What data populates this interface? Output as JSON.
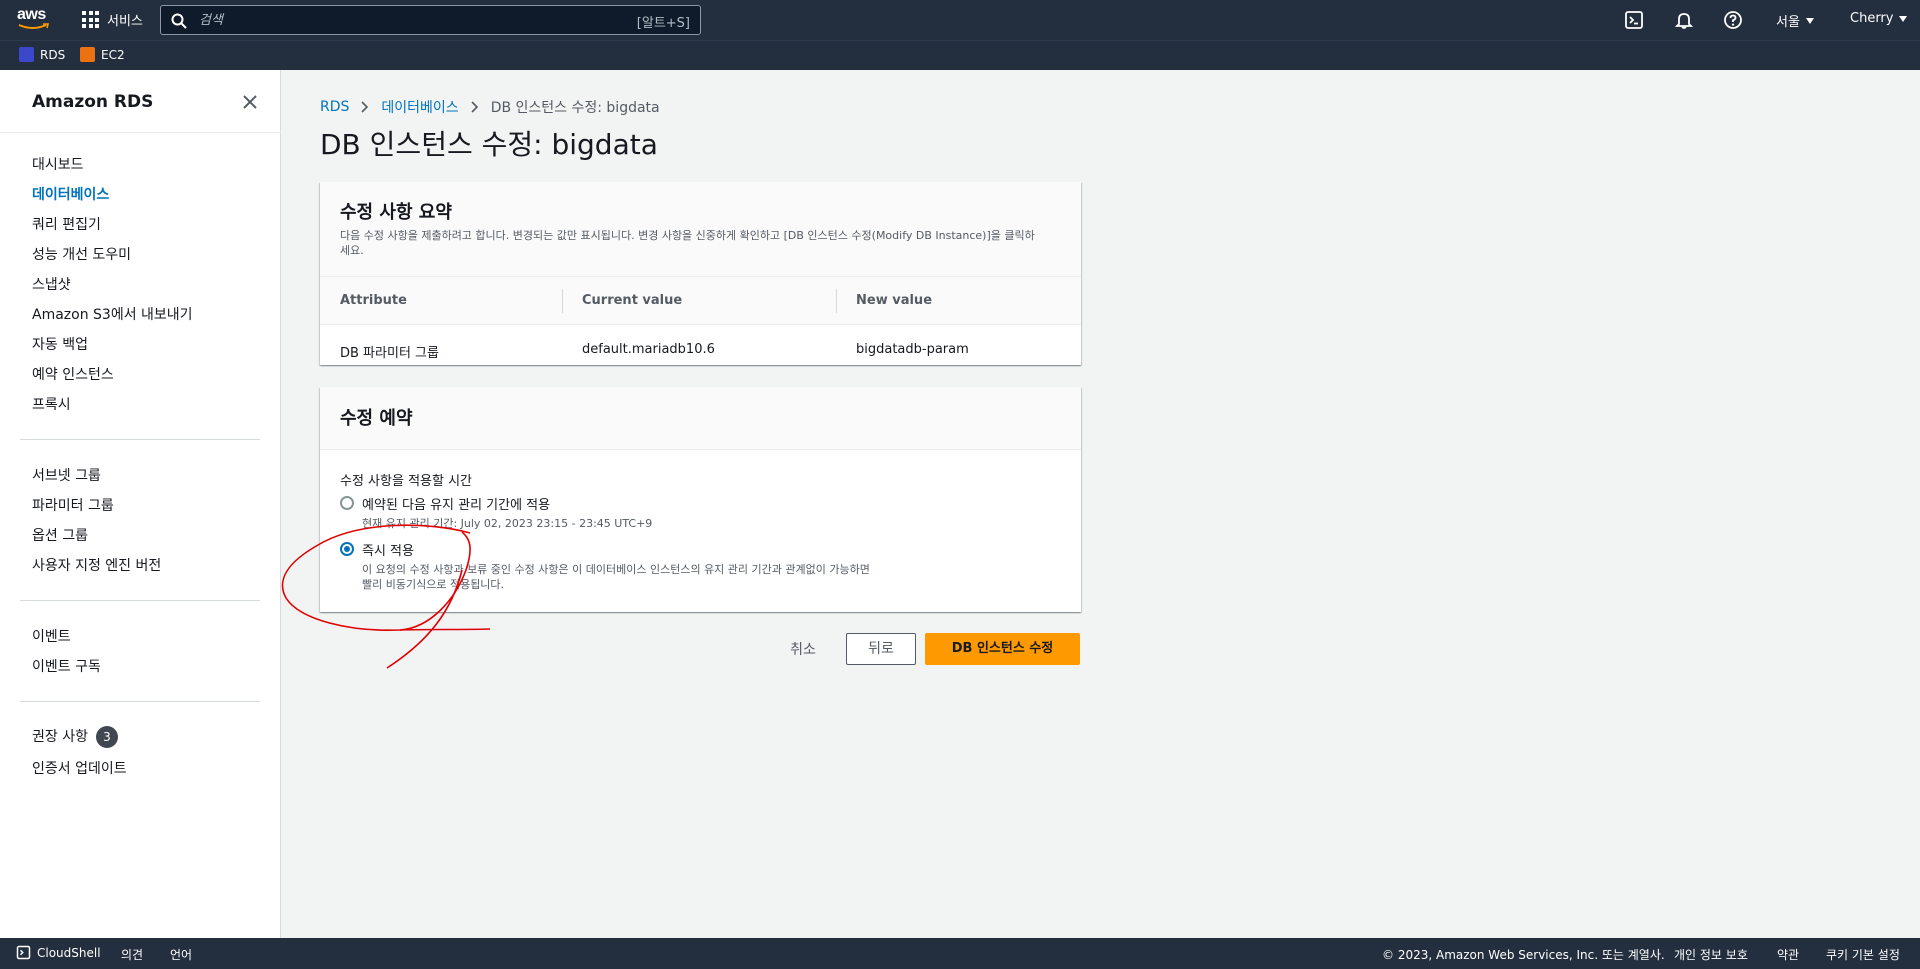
{
  "topnav": {
    "logo_text": "aws",
    "services_label": "서비스",
    "search_placeholder": "검색",
    "search_shortcut": "[알트+S]",
    "region": "서울",
    "user": "Cherry"
  },
  "favorites": [
    {
      "label": "RDS",
      "color": "#3b48cc"
    },
    {
      "label": "EC2",
      "color": "#ec7211"
    }
  ],
  "sidebar": {
    "title": "Amazon RDS",
    "group1": [
      "대시보드",
      "데이터베이스",
      "쿼리 편집기",
      "성능 개선 도우미",
      "스냅샷",
      "Amazon S3에서 내보내기",
      "자동 백업",
      "예약 인스턴스",
      "프록시"
    ],
    "active": "데이터베이스",
    "group2": [
      "서브넷 그룹",
      "파라미터 그룹",
      "옵션 그룹",
      "사용자 지정 엔진 버전"
    ],
    "group3": [
      "이벤트",
      "이벤트 구독"
    ],
    "group4_recommend": "권장 사항",
    "group4_badge": "3",
    "group4_cert": "인증서 업데이트"
  },
  "breadcrumb": {
    "root": "RDS",
    "databases": "데이터베이스",
    "current": "DB 인스턴스 수정: bigdata"
  },
  "page_title": "DB 인스턴스 수정: bigdata",
  "summary": {
    "title": "수정 사항 요약",
    "desc": "다음 수정 사항을 제출하려고 합니다. 변경되는 값만 표시됩니다. 변경 사항을 신중하게 확인하고 [DB 인스턴스 수정(Modify DB Instance)]을 클릭하세요.",
    "columns": [
      "Attribute",
      "Current value",
      "New value"
    ],
    "row": [
      "DB 파라미터 그룹",
      "default.mariadb10.6",
      "bigdatadb-param"
    ]
  },
  "schedule": {
    "title": "수정 예약",
    "label": "수정 사항을 적용할 시간",
    "option1_label": "예약된 다음 유지 관리 기간에 적용",
    "option1_desc": "현재 유지 관리 기간: July 02, 2023 23:15 - 23:45 UTC+9",
    "option2_label": "즉시 적용",
    "option2_desc": "이 요청의 수정 사항과 보류 중인 수정 사항은 이 데이터베이스 인스턴스의 유지 관리 기간과 관계없이 가능하면 빨리 비동기식으로 적용됩니다.",
    "selected": "option2"
  },
  "actions": {
    "cancel": "취소",
    "back": "뒤로",
    "submit": "DB 인스턴스 수정"
  },
  "footer": {
    "cloudshell": "CloudShell",
    "feedback": "의견",
    "language": "언어",
    "copyright": "© 2023, Amazon Web Services, Inc. 또는 계열사.",
    "privacy": "개인 정보 보호",
    "terms": "약관",
    "cookies": "쿠키 기본 설정"
  },
  "colors": {
    "nav_bg": "#232f3e",
    "link": "#0073bb",
    "primary_button": "#ff9900",
    "annotation": "#e00000"
  }
}
